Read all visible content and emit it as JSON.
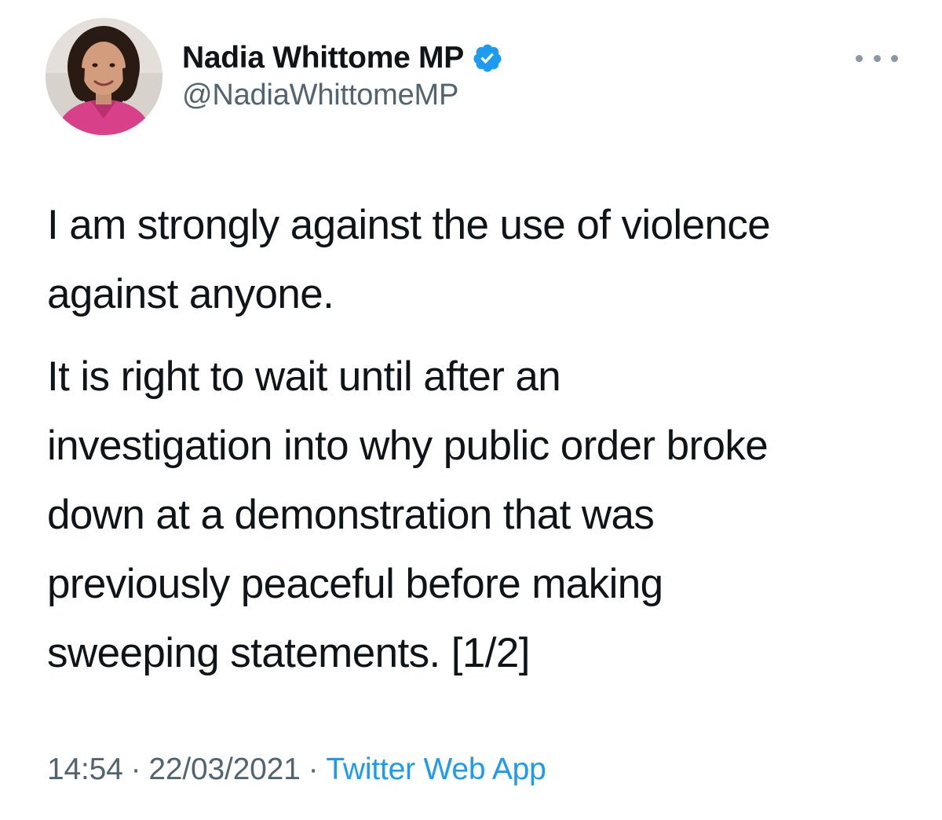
{
  "author": {
    "display_name": "Nadia Whittome MP",
    "handle": "@NadiaWhittomeMP",
    "verified": true,
    "avatar_icon": "profile-photo",
    "verified_icon": "verified-badge-icon"
  },
  "more_button": {
    "icon": "more-horizontal-icon"
  },
  "tweet": {
    "paragraph_1": "I am strongly against the use of violence\nagainst anyone.",
    "paragraph_2": "It is right to wait until after an\ninvestigation into why public order broke\ndown at a demonstration that was\npreviously peaceful before making\nsweeping statements. [1/2]"
  },
  "meta": {
    "time": "14:54",
    "separator": "·",
    "date": "22/03/2021",
    "source": "Twitter Web App"
  },
  "colors": {
    "text": "#0f1419",
    "secondary": "#536471",
    "accent": "#1d9bf0",
    "verified": "#1d9bf0"
  }
}
